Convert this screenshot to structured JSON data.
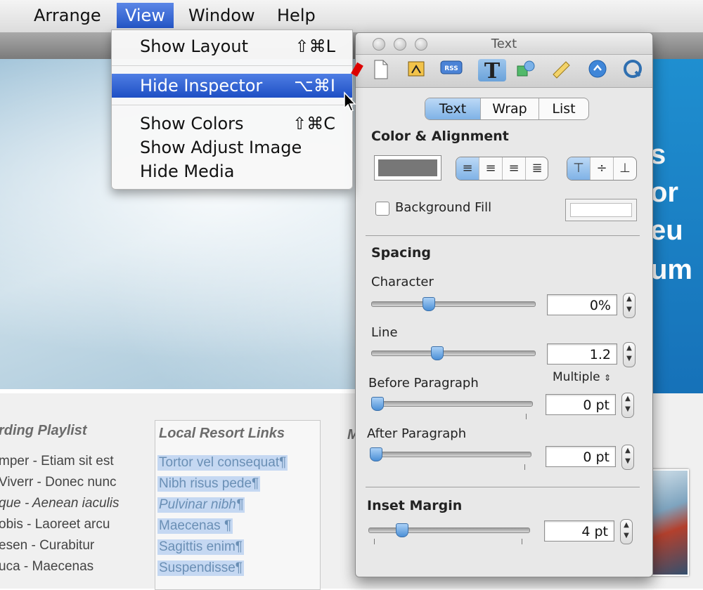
{
  "menubar": {
    "items": [
      "Arrange",
      "View",
      "Window",
      "Help"
    ],
    "active": "View"
  },
  "view_menu": {
    "items": [
      {
        "label": "Show Layout",
        "shortcut": "⇧⌘L"
      },
      {
        "label": "Hide Inspector",
        "shortcut": "⌥⌘I",
        "highlighted": true
      },
      {
        "label": "Show Colors",
        "shortcut": "⇧⌘C"
      },
      {
        "label": "Show Adjust Image",
        "shortcut": ""
      },
      {
        "label": "Hide Media",
        "shortcut": ""
      }
    ]
  },
  "background_page": {
    "hero_words": [
      "s",
      "or",
      "eu",
      "um"
    ],
    "playlist_title": "rding Playlist",
    "playlist_lines": [
      "mper - Etiam sit est",
      " Viverr - Donec nunc",
      "que - Aenean iaculis",
      "obis - Laoreet arcu",
      "esen - Curabitur",
      "uca - Maecenas"
    ],
    "links_title": "Local Resort Links",
    "links": [
      "Tortor vel consequat¶",
      "Nibh risus pede¶",
      "Pulvinar nibh¶",
      "Maecenas ¶",
      "Sagittis enim¶",
      "Suspendisse¶"
    ],
    "third_col_initial": "M"
  },
  "inspector": {
    "title": "Text",
    "toolbar_icons": [
      "document-icon",
      "layout-icon",
      "rss-icon",
      "text-icon",
      "shapes-icon",
      "ruler-icon",
      "link-icon",
      "quicktime-icon"
    ],
    "selected_toolbar": "text-icon",
    "tabs": [
      "Text",
      "Wrap",
      "List"
    ],
    "active_tab": "Text",
    "color_alignment": {
      "heading": "Color & Alignment",
      "text_color": "#777777",
      "h_align": [
        "align-left-icon",
        "align-center-icon",
        "align-right-icon",
        "align-justify-icon"
      ],
      "h_align_selected": "align-left-icon",
      "v_align": [
        "align-top-icon",
        "align-middle-icon",
        "align-bottom-icon"
      ],
      "v_align_selected": "align-top-icon",
      "background_fill_label": "Background Fill",
      "background_fill_checked": false
    },
    "spacing": {
      "heading": "Spacing",
      "character_label": "Character",
      "character_value": "0%",
      "character_level": 0.35,
      "line_label": "Line",
      "line_value": "1.2",
      "line_level": 0.4,
      "line_mode": "Multiple",
      "before_label": "Before Paragraph",
      "before_value": "0 pt",
      "before_level": 0,
      "after_label": "After Paragraph",
      "after_value": "0 pt",
      "after_level": 0
    },
    "inset": {
      "heading": "Inset Margin",
      "value": "4 pt",
      "level": 0.17
    }
  },
  "colors": {
    "menu_highlight": "#2456c6",
    "selection": "#c5d8f2",
    "hero_accent": "#1f8fd0"
  }
}
